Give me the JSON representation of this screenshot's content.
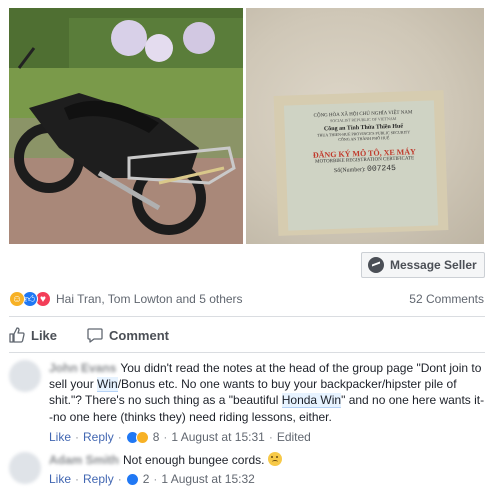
{
  "post": {
    "message_button_label": "Message Seller",
    "reaction_summary": "Hai Tran, Tom Lowton and 5 others",
    "comments_count": "52 Comments",
    "actions": {
      "like": "Like",
      "comment": "Comment"
    },
    "photos": {
      "left_description": "motorbike-photo",
      "right_description": "registration-card-photo"
    },
    "registration_card": {
      "line1": "CỘNG HÒA XÃ HỘI CHỦ NGHĨA VIỆT NAM",
      "line2": "SOCIALIST REPUBLIC OF VIETNAM",
      "line3": "Công an Tỉnh Thừa Thiên Huế",
      "line4": "THUA THIEN-HUE PROVINCE'S PUBLIC SECURITY",
      "line5": "CÔNG AN THÀNH PHỐ HUẾ",
      "title": "ĐĂNG KÝ MÔ TÔ, XE MÁY",
      "subtitle": "MOTORBIKE REGISTRATION CERTIFICATE",
      "number_label": "Số(Number):",
      "number": "007245"
    }
  },
  "comments": [
    {
      "author": "John Evans",
      "text_parts": [
        "You didn't read the notes at the head of the group page \"Dont join to sell your ",
        "Win",
        "/Bonus etc. No one wants to buy your backpacker/hipster pile of shit.\"? There's no such thing as a \"beautiful ",
        "Honda Win",
        "\" and no one here wants it--no one here (thinks they) need riding lessons, either."
      ],
      "like": "Like",
      "reply": "Reply",
      "reaction_count": "8",
      "time": "1 August at 15:31",
      "edited": "Edited"
    },
    {
      "author": "Adam Smith",
      "text": "Not enough bungee cords.",
      "like": "Like",
      "reply": "Reply",
      "reaction_count": "2",
      "time": "1 August at 15:32"
    }
  ],
  "colors": {
    "link": "#4267b2",
    "like_blue": "#2078f4",
    "haha_yellow": "#f7b125",
    "love_red": "#f33e58"
  }
}
